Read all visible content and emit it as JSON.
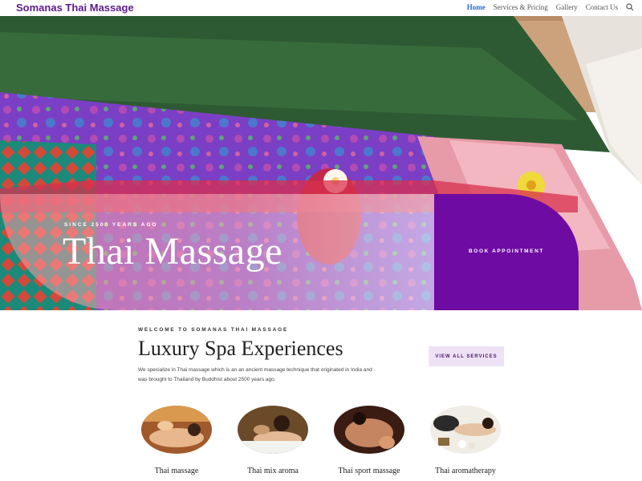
{
  "site": {
    "logo": "Somanas Thai Massage"
  },
  "nav": {
    "items": [
      {
        "label": "Home",
        "active": true
      },
      {
        "label": "Services & Pricing",
        "active": false
      },
      {
        "label": "Gallery",
        "active": false
      },
      {
        "label": "Contact Us",
        "active": false
      }
    ],
    "search_icon": "search-icon"
  },
  "hero": {
    "eyebrow": "SINCE 2500 YEARS AGO",
    "title": "Thai Massage",
    "book_button": "BOOK APPOINTMENT"
  },
  "welcome": {
    "eyebrow": "WELCOME TO SOMANAS THAI MASSAGE",
    "title": "Luxury Spa Experiences",
    "text": "We specialize in Thai massage which is an an ancient massage technique that originated in India and was brought to Thailand by Buddhist about 2500 years ago.",
    "view_all": "VIEW ALL SERVICES"
  },
  "services": [
    {
      "label": "Thai massage"
    },
    {
      "label": "Thai mix aroma"
    },
    {
      "label": "Thai sport massage"
    },
    {
      "label": "Thai aromatherapy"
    }
  ],
  "colors": {
    "brand_purple": "#5d1a8c",
    "book_purple": "#6d0ba3",
    "nav_active": "#2a6ad4",
    "button_tint": "#efe2f6"
  }
}
